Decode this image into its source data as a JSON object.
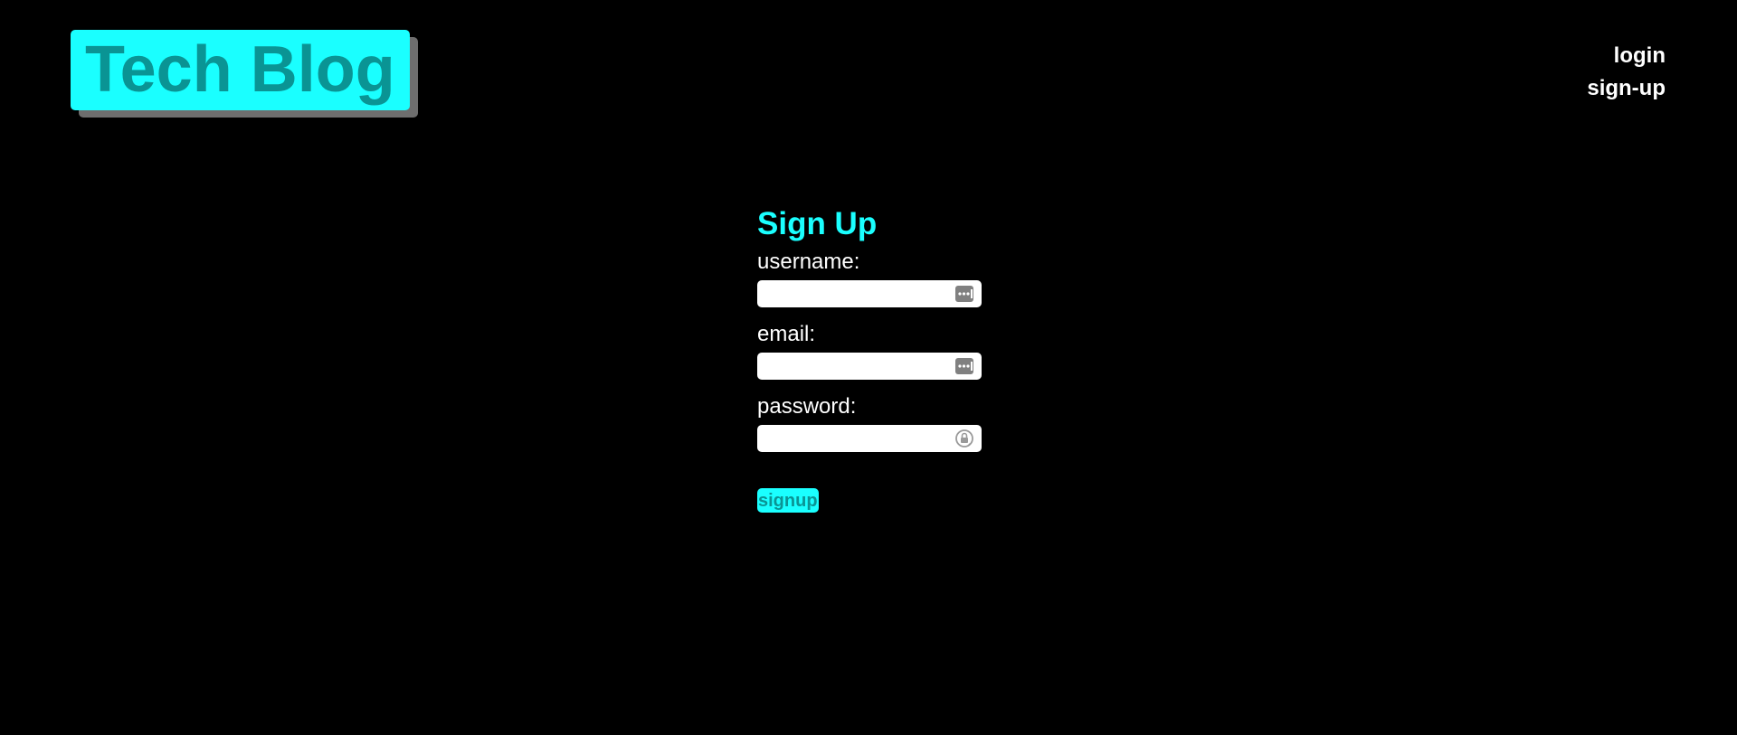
{
  "header": {
    "logo_text": "Tech Blog",
    "nav": {
      "login_label": "login",
      "signup_label": "sign-up"
    }
  },
  "signup_form": {
    "title": "Sign Up",
    "fields": [
      {
        "label": "username:",
        "value": "",
        "icon": "autofill-dots-icon"
      },
      {
        "label": "email:",
        "value": "",
        "icon": "autofill-dots-icon"
      },
      {
        "label": "password:",
        "value": "",
        "icon": "password-lock-icon"
      }
    ],
    "submit_label": "signup"
  },
  "colors": {
    "background": "#000000",
    "accent": "#1affff",
    "accent_text": "#0a9494",
    "logo_shadow": "#6e6e6e",
    "text": "#ffffff"
  }
}
